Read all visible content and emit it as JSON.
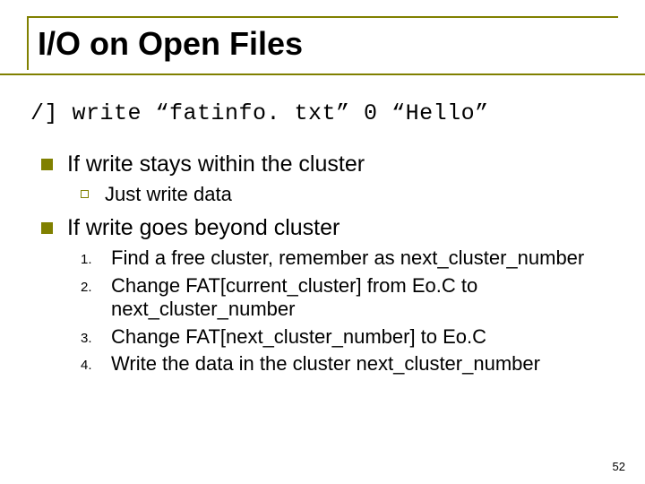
{
  "title": "I/O on Open Files",
  "command": "/] write “fatinfo. txt” 0 “Hello”",
  "sections": [
    {
      "heading": "If write stays within the cluster",
      "sub": [
        {
          "kind": "square",
          "text": "Just write data"
        }
      ]
    },
    {
      "heading": "If write goes beyond cluster",
      "sub": [
        {
          "kind": "num",
          "marker": "1.",
          "text": "Find a free cluster, remember as next_cluster_number"
        },
        {
          "kind": "num",
          "marker": "2.",
          "text": "Change FAT[current_cluster] from Eo.C to next_cluster_number"
        },
        {
          "kind": "num",
          "marker": "3.",
          "text": "Change FAT[next_cluster_number] to Eo.C"
        },
        {
          "kind": "num",
          "marker": "4.",
          "text": "Write the data in the cluster next_cluster_number"
        }
      ]
    }
  ],
  "page_number": "52"
}
